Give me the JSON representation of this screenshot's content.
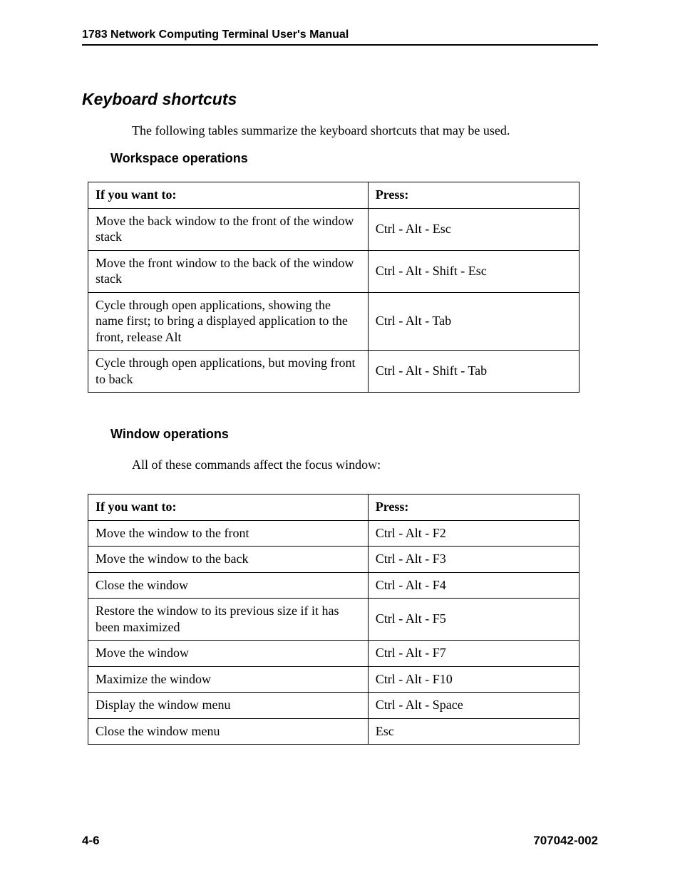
{
  "header": "1783 Network Computing Terminal User's Manual",
  "section": {
    "title": "Keyboard shortcuts",
    "intro": "The following tables summarize the keyboard shortcuts that may be used."
  },
  "workspace": {
    "title": "Workspace operations",
    "col_action": "If you want to:",
    "col_press": "Press:",
    "rows": [
      {
        "action": "Move the back window to the front of the window stack",
        "press": "Ctrl - Alt - Esc"
      },
      {
        "action": "Move the front window to the back of the window stack",
        "press": "Ctrl - Alt - Shift - Esc"
      },
      {
        "action": "Cycle through open applications, showing the name first; to bring a displayed application to the front, release Alt",
        "press": "Ctrl - Alt - Tab"
      },
      {
        "action": "Cycle through open applications, but moving front to back",
        "press": "Ctrl - Alt - Shift - Tab"
      }
    ]
  },
  "window": {
    "title": "Window operations",
    "intro": "All of these commands affect the focus window:",
    "col_action": "If you want to:",
    "col_press": "Press:",
    "rows": [
      {
        "action": "Move the window to the front",
        "press": "Ctrl - Alt - F2"
      },
      {
        "action": "Move the window to the back",
        "press": "Ctrl - Alt - F3"
      },
      {
        "action": "Close the window",
        "press": "Ctrl - Alt - F4"
      },
      {
        "action": "Restore the window to its previous size if it has been maximized",
        "press": "Ctrl - Alt - F5"
      },
      {
        "action": "Move the window",
        "press": "Ctrl - Alt - F7"
      },
      {
        "action": "Maximize the window",
        "press": "Ctrl - Alt - F10"
      },
      {
        "action": "Display the window menu",
        "press": "Ctrl - Alt - Space"
      },
      {
        "action": "Close the window menu",
        "press": "Esc"
      }
    ]
  },
  "footer": {
    "page": "4-6",
    "docnum": "707042-002"
  }
}
